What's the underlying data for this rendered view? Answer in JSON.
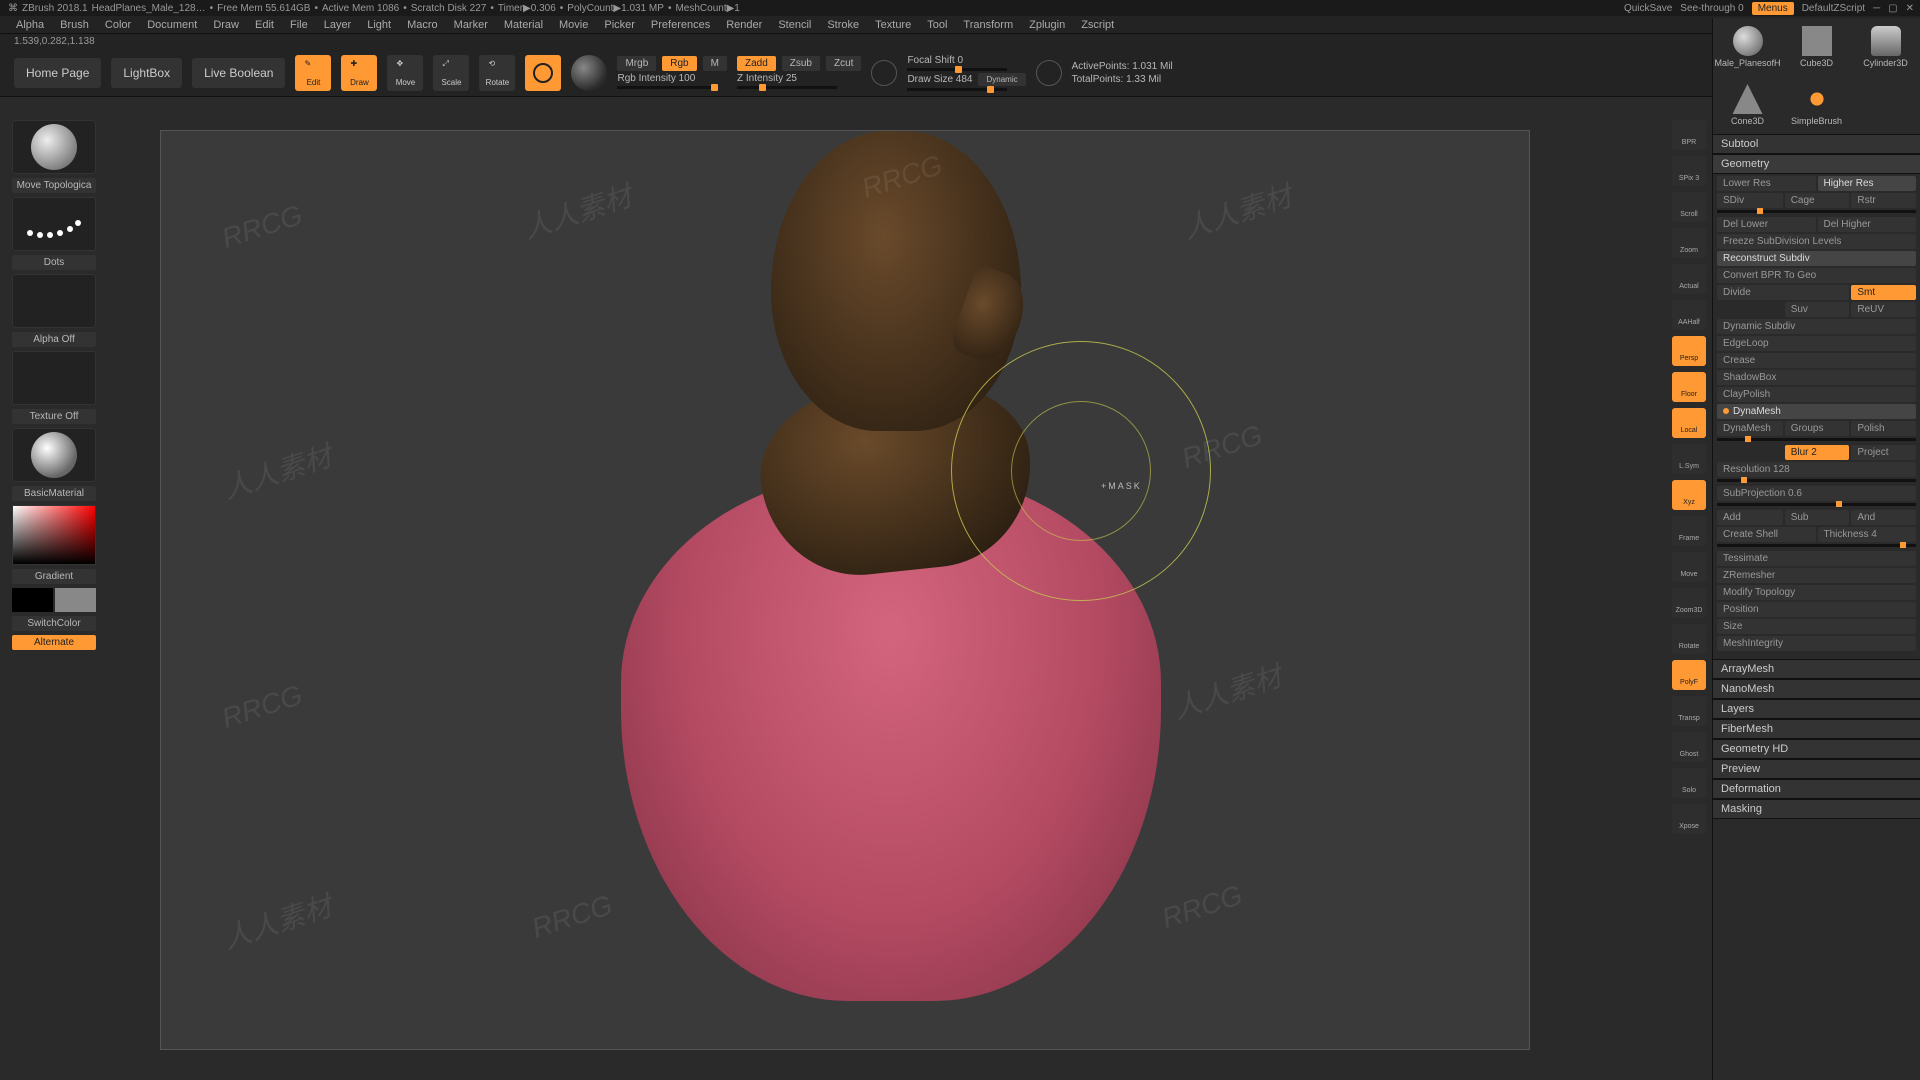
{
  "title": {
    "app": "ZBrush 2018.1",
    "doc": "HeadPlanes_Male_128…",
    "freemem": "Free Mem 55.614GB",
    "activemem": "Active Mem 1086",
    "scratch": "Scratch Disk 227",
    "timer": "Timer▶0.306",
    "polycount": "PolyCount▶1.031 MP",
    "meshcount": "MeshCount▶1",
    "quicksave": "QuickSave",
    "seethrough": "See-through  0",
    "menus": "Menus",
    "defaultzscript": "DefaultZScript"
  },
  "menu": [
    "Alpha",
    "Brush",
    "Color",
    "Document",
    "Draw",
    "Edit",
    "File",
    "Layer",
    "Light",
    "Macro",
    "Marker",
    "Material",
    "Movie",
    "Picker",
    "Preferences",
    "Render",
    "Stencil",
    "Stroke",
    "Texture",
    "Tool",
    "Transform",
    "Zplugin",
    "Zscript"
  ],
  "coord": "1.539,0.282,1.138",
  "top": {
    "homepage": "Home Page",
    "lightbox": "LightBox",
    "liveboolean": "Live Boolean",
    "edit": "Edit",
    "draw": "Draw",
    "move": "Move",
    "scale": "Scale",
    "rotate": "Rotate",
    "mrgb": "Mrgb",
    "rgb": "Rgb",
    "m": "M",
    "rgbintensity": "Rgb Intensity 100",
    "zadd": "Zadd",
    "zsub": "Zsub",
    "zcut": "Zcut",
    "zintensity": "Z Intensity 25",
    "focalshift": "Focal Shift 0",
    "drawsize": "Draw Size 484",
    "dynamic": "Dynamic",
    "activepoints": "ActivePoints: 1.031 Mil",
    "totalpoints": "TotalPoints: 1.33 Mil"
  },
  "left": {
    "brush": "Move Topologica",
    "stroke": "Dots",
    "alpha": "Alpha Off",
    "texture": "Texture Off",
    "material": "BasicMaterial",
    "gradient": "Gradient",
    "switchcolor": "SwitchColor",
    "alternate": "Alternate"
  },
  "righttool": [
    "BPR",
    "SPix 3",
    "Scroll",
    "Zoom",
    "Actual",
    "AAHalf",
    "Persp",
    "Floor",
    "Local",
    "L.Sym",
    "Xyz",
    "Frame",
    "Move",
    "Zoom3D",
    "Rotate",
    "PolyF",
    "Transp",
    "Ghost",
    "Solo",
    "Xpose"
  ],
  "rttool_active": [
    6,
    7,
    8,
    10,
    15
  ],
  "quicktools": [
    {
      "label": "Male_PlanesofH",
      "shape": "sphere"
    },
    {
      "label": "Cube3D",
      "shape": "cube"
    },
    {
      "label": "Cylinder3D",
      "shape": "cyl"
    },
    {
      "label": "Cone3D",
      "shape": "cone"
    },
    {
      "label": "SimpleBrush",
      "shape": "swirl"
    }
  ],
  "panel": {
    "subtool": "Subtool",
    "geometry": "Geometry",
    "lowerres": "Lower Res",
    "higherres": "Higher Res",
    "sdiv": "SDiv",
    "cage": "Cage",
    "rstr": "Rstr",
    "dellower": "Del Lower",
    "delhigher": "Del Higher",
    "freeze": "Freeze SubDivision Levels",
    "reconstruct": "Reconstruct Subdiv",
    "convertbpr": "Convert BPR To Geo",
    "divide": "Divide",
    "smt": "Smt",
    "suv": "Suv",
    "reuv": "ReUV",
    "dynamicsubdiv": "Dynamic Subdiv",
    "edgeloop": "EdgeLoop",
    "crease": "Crease",
    "shadowbox": "ShadowBox",
    "claypolish": "ClayPolish",
    "dynamesh_hd": "DynaMesh",
    "dynamesh": "DynaMesh",
    "groups": "Groups",
    "polish": "Polish",
    "blur2": "Blur 2",
    "project": "Project",
    "resolution": "Resolution 128",
    "subprojection": "SubProjection 0.6",
    "add": "Add",
    "sub": "Sub",
    "and": "And",
    "createshell": "Create Shell",
    "thickness": "Thickness 4",
    "tessimate": "Tessimate",
    "zremesher": "ZRemesher",
    "modifytopo": "Modify Topology",
    "position": "Position",
    "size": "Size",
    "meshintegrity": "MeshIntegrity",
    "arraymesh": "ArrayMesh",
    "nanomesh": "NanoMesh",
    "layers": "Layers",
    "fibermesh": "FiberMesh",
    "geometryhd": "Geometry HD",
    "preview": "Preview",
    "deformation": "Deformation",
    "masking": "Masking"
  },
  "brushlabel": "+MASK"
}
